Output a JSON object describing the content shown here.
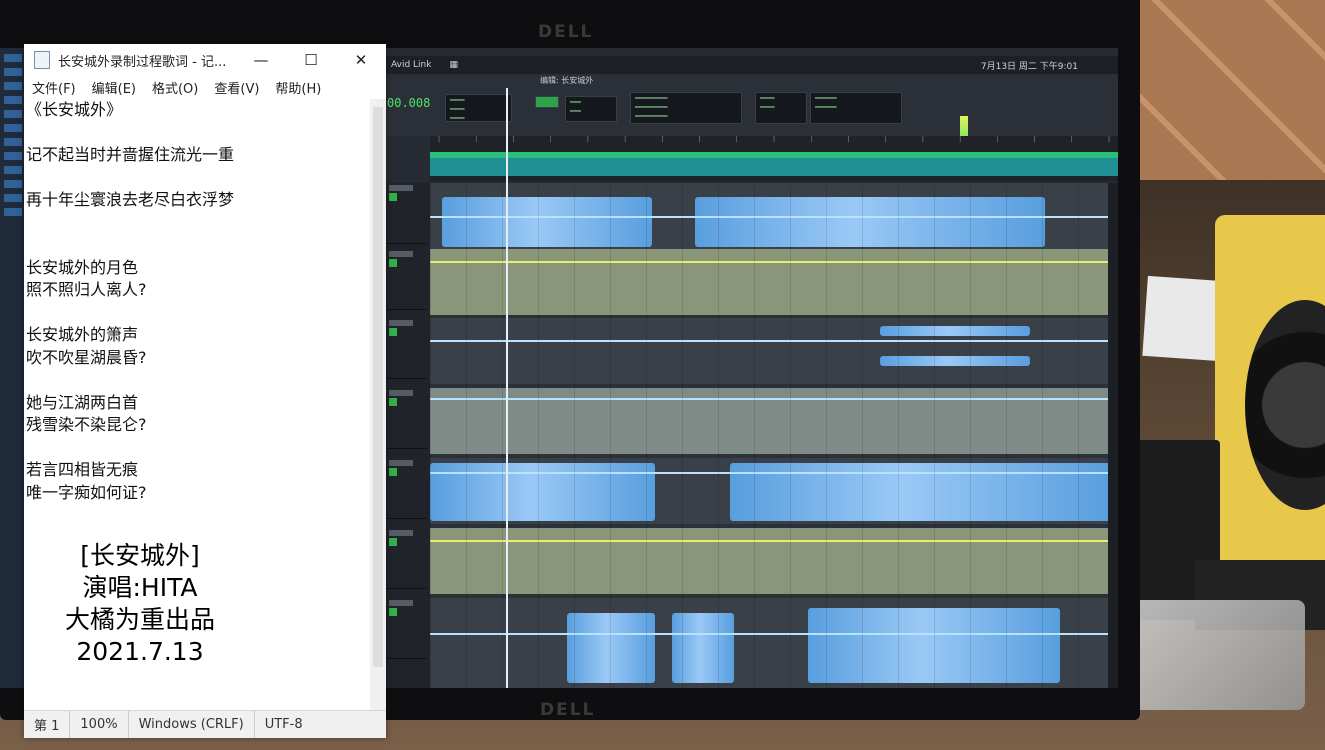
{
  "notepad": {
    "title": "长安城外录制过程歌词 - 记...",
    "controls": {
      "minimize": "—",
      "maximize": "☐",
      "close": "✕"
    },
    "menu": [
      "文件(F)",
      "编辑(E)",
      "格式(O)",
      "查看(V)",
      "帮助(H)"
    ],
    "lines": [
      "《长安城外》",
      "",
      "记不起当时并啬握住流光一重",
      "",
      "再十年尘寰浪去老尽白衣浮梦",
      "",
      "",
      "长安城外的月色",
      "照不照归人离人?",
      "",
      "长安城外的箫声",
      "吹不吹星湖晨昏?",
      "",
      "她与江湖两白首",
      "残雪染不染昆仑?",
      "",
      "若言四相皆无痕",
      "唯一字痴如何证?"
    ],
    "status": {
      "position": "第 1",
      "zoom": "100%",
      "line_ending": "Windows (CRLF)",
      "encoding": "UTF-8"
    }
  },
  "credit": {
    "song": "[长安城外]",
    "singer": "演唱:HITA",
    "producer": "大橘为重出品",
    "date": "2021.7.13"
  },
  "daw": {
    "menu_left": "Avid Link",
    "tab_title": "编辑:  长安城外",
    "counter": "00.008",
    "clock": "7月13日 周二 下午9:01",
    "monitor_brand": "DELL"
  }
}
